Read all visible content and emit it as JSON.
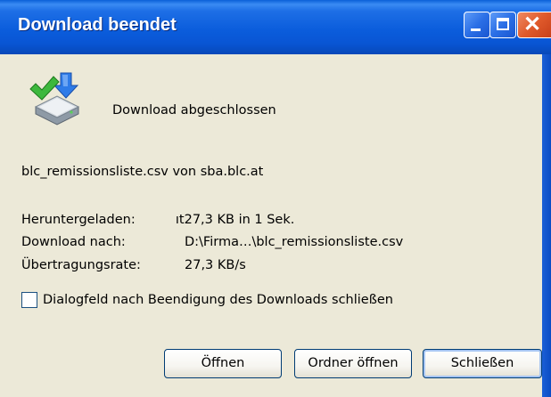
{
  "window": {
    "title": "Download beendet"
  },
  "titlebar_buttons": {
    "minimize": "minimize",
    "maximize": "maximize",
    "close": "close"
  },
  "icon": "download-complete-icon",
  "message": "Download abgeschlossen",
  "file_source": "blc_remissionsliste.csv von sba.blc.at",
  "details": {
    "downloaded_label": "Heruntergeladen:",
    "downloaded_value": " ıt27,3 KB in 1 Sek.",
    "target_label": "Download nach:",
    "target_value": "D:\\Firma…\\blc_remissionsliste.csv",
    "rate_label": "Übertragungsrate:",
    "rate_value": "27,3 KB/s"
  },
  "checkbox": {
    "label": "Dialogfeld nach Beendigung des Downloads schließen",
    "checked": false
  },
  "buttons": {
    "open": "Öffnen",
    "open_folder": "Ordner öffnen",
    "close": "Schließen"
  },
  "colors": {
    "titlebar": "#0B5DDC",
    "dialog_bg": "#ECE9D8",
    "close_button": "#E05A2B",
    "button_border": "#003C74"
  }
}
